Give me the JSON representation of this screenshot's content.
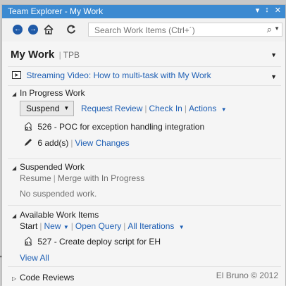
{
  "window": {
    "title": "Team Explorer - My Work",
    "controls": [
      "▾",
      "📌",
      "✕"
    ]
  },
  "toolbar": {
    "search_placeholder": "Search Work Items (Ctrl+´)"
  },
  "page": {
    "title": "My Work",
    "context": "TPB"
  },
  "video_link": "Streaming Video: How to multi-task with My Work",
  "in_progress": {
    "header": "In Progress Work",
    "suspend_label": "Suspend",
    "actions": [
      "Request Review",
      "Check In",
      "Actions"
    ],
    "work_item": "526 - POC for exception handling integration",
    "changes_count": "6 add(s)",
    "view_changes": "View Changes"
  },
  "suspended": {
    "header": "Suspended Work",
    "resume": "Resume",
    "merge": "Merge with In Progress",
    "empty_text": "No suspended work."
  },
  "available": {
    "header": "Available Work Items",
    "start": "Start",
    "new": "New",
    "open_query": "Open Query",
    "iterations": "All Iterations",
    "work_item": "527 - Create deploy script for EH",
    "view_all": "View All"
  },
  "code_reviews": {
    "header": "Code Reviews"
  },
  "footer": {
    "watermark": "El Bruno © 2012"
  },
  "colors": {
    "title_bar": "#3c8ad1",
    "link": "#1e5fb4",
    "nav_button": "#1f5aa8"
  }
}
